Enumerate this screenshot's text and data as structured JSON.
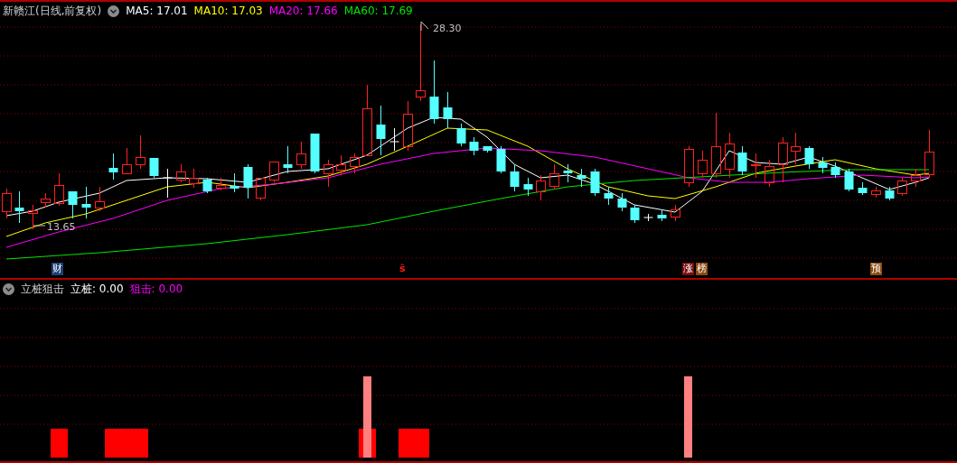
{
  "header": {
    "title": "新赣江(日线,前复权)",
    "ma": [
      {
        "label": "MA5: 17.01",
        "color": "#ffffff"
      },
      {
        "label": "MA10: 17.03",
        "color": "#ffff00"
      },
      {
        "label": "MA20: 17.66",
        "color": "#ff00ff"
      },
      {
        "label": "MA60: 17.69",
        "color": "#00e600"
      }
    ]
  },
  "chart": {
    "high_label": "28.30",
    "low_label": "13.65",
    "markers": [
      {
        "text": "财",
        "kind": "badge",
        "color": "#1d3f73"
      },
      {
        "text": "ŝ",
        "kind": "plain",
        "color": "#ff1a1a"
      },
      {
        "text": "涨",
        "kind": "badge",
        "color": "#7a0e0e"
      },
      {
        "text": "榜",
        "kind": "badge",
        "color": "#8a4a10"
      },
      {
        "text": "预",
        "kind": "badge",
        "color": "#8a4a10"
      }
    ]
  },
  "indicator": {
    "title": "立桩狙击",
    "readings": [
      {
        "label": "立桩: 0.00",
        "color": "#ffffff"
      },
      {
        "label": "狙击: 0.00",
        "color": "#ff00ff"
      }
    ]
  }
}
